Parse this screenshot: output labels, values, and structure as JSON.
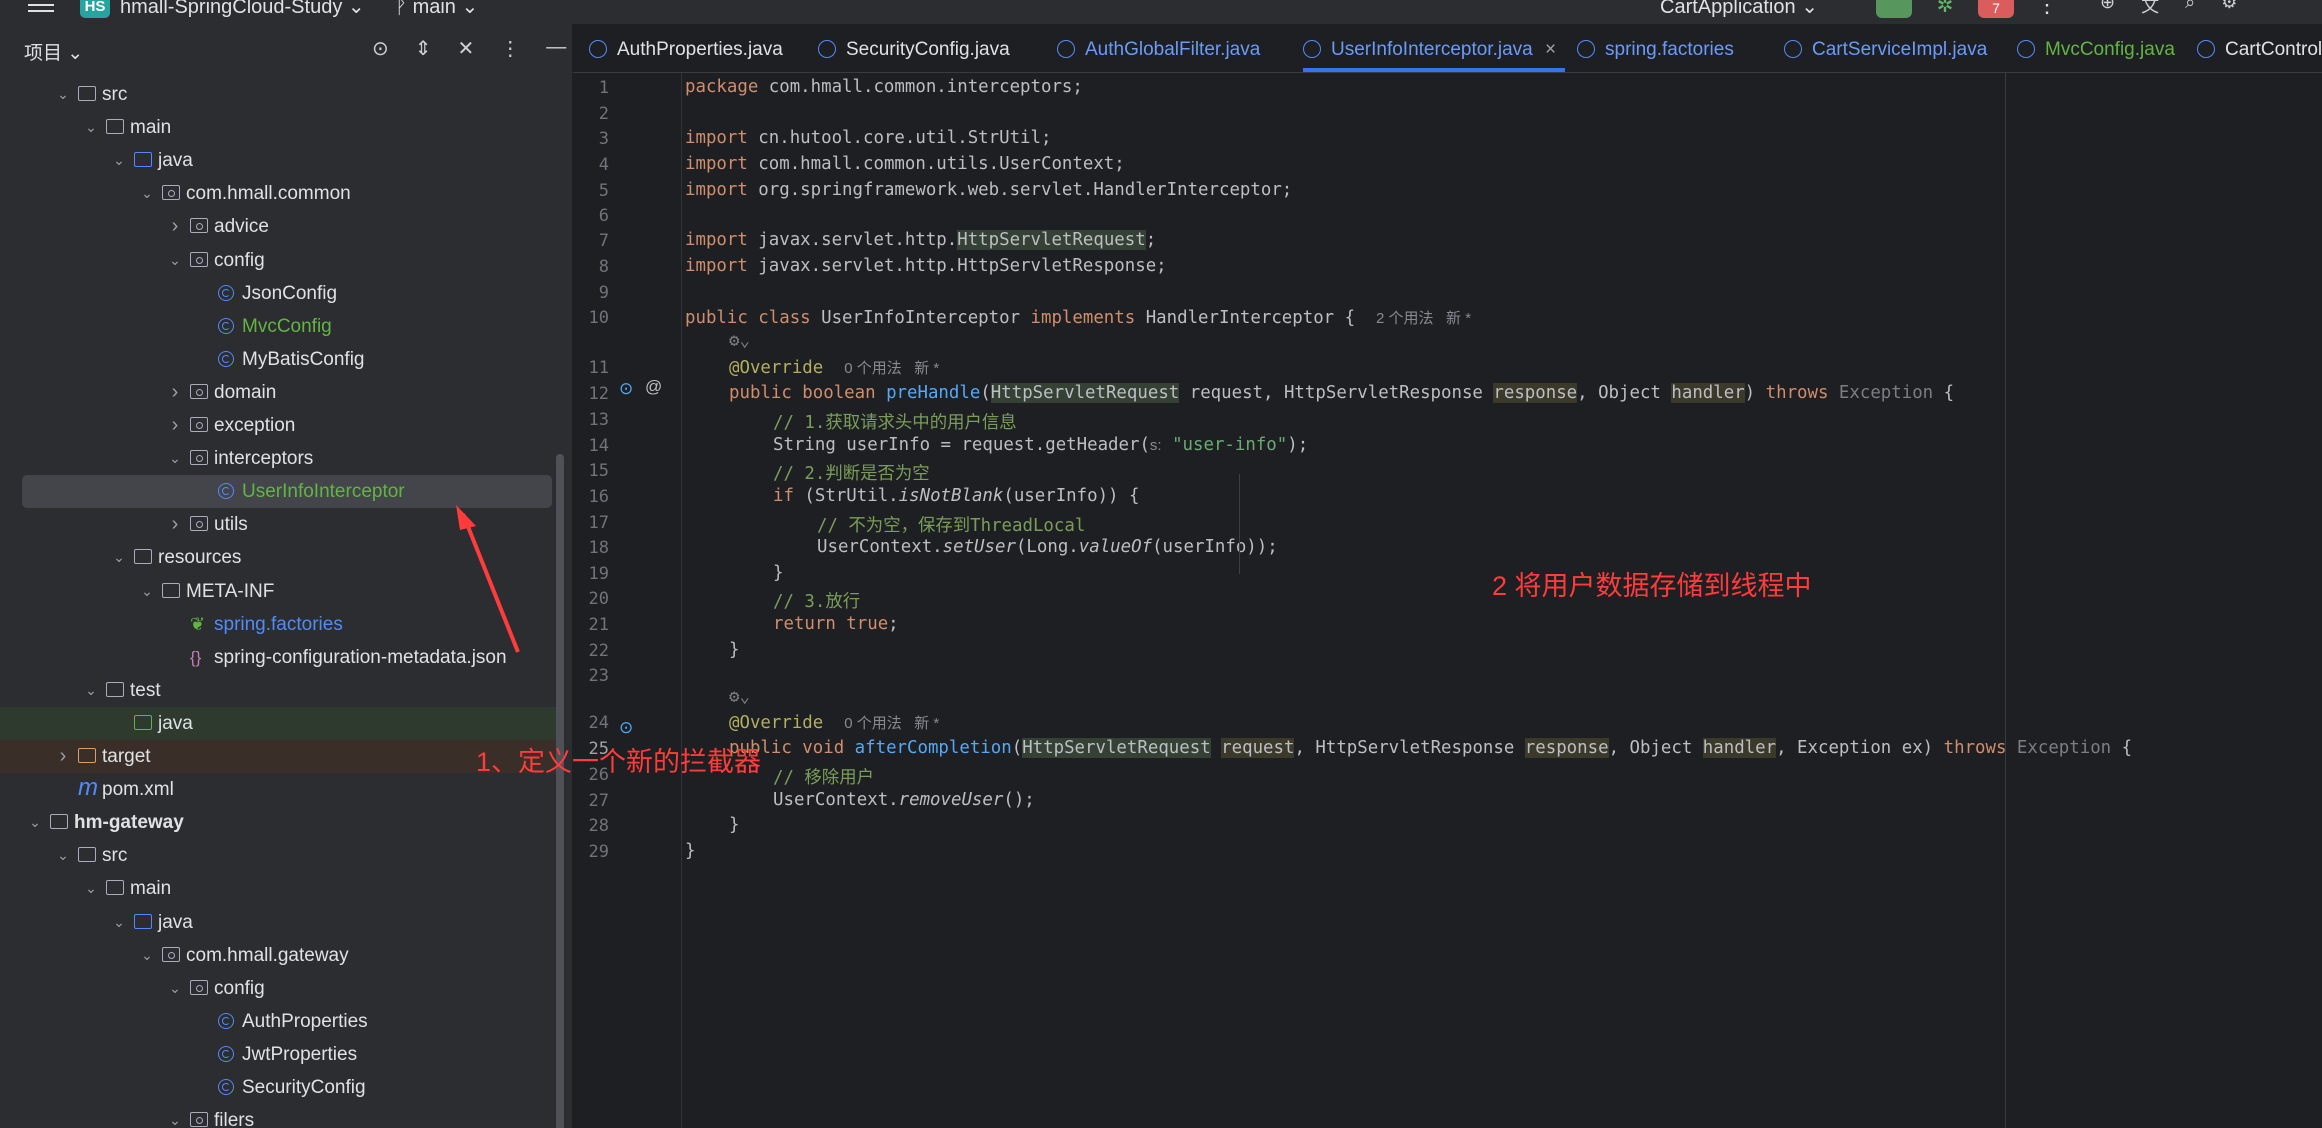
{
  "titlebar": {
    "project_badge": "HS",
    "project_name": "hmall-SpringCloud-Study",
    "branch": "main",
    "run_config": "CartApplication",
    "stop_badge": "7"
  },
  "project_panel": {
    "title": "项目",
    "items": [
      {
        "label": "src",
        "depth": 3,
        "arrow": "down",
        "icon": "folder"
      },
      {
        "label": "main",
        "depth": 4,
        "arrow": "down",
        "icon": "folder"
      },
      {
        "label": "java",
        "depth": 5,
        "arrow": "down",
        "icon": "folder-src"
      },
      {
        "label": "com.hmall.common",
        "depth": 6,
        "arrow": "down",
        "icon": "package"
      },
      {
        "label": "advice",
        "depth": 7,
        "arrow": "right",
        "icon": "package"
      },
      {
        "label": "config",
        "depth": 7,
        "arrow": "down",
        "icon": "package"
      },
      {
        "label": "JsonConfig",
        "depth": 8,
        "arrow": "",
        "icon": "class"
      },
      {
        "label": "MvcConfig",
        "depth": 8,
        "arrow": "",
        "icon": "class",
        "color": "#62b543"
      },
      {
        "label": "MyBatisConfig",
        "depth": 8,
        "arrow": "",
        "icon": "class"
      },
      {
        "label": "domain",
        "depth": 7,
        "arrow": "right",
        "icon": "package"
      },
      {
        "label": "exception",
        "depth": 7,
        "arrow": "right",
        "icon": "package"
      },
      {
        "label": "interceptors",
        "depth": 7,
        "arrow": "down",
        "icon": "package"
      },
      {
        "label": "UserInfoInterceptor",
        "depth": 8,
        "arrow": "",
        "icon": "class",
        "color": "#62b543",
        "selected": true
      },
      {
        "label": "utils",
        "depth": 7,
        "arrow": "right",
        "icon": "package"
      },
      {
        "label": "resources",
        "depth": 5,
        "arrow": "down",
        "icon": "folder"
      },
      {
        "label": "META-INF",
        "depth": 6,
        "arrow": "down",
        "icon": "folder"
      },
      {
        "label": "spring.factories",
        "depth": 7,
        "arrow": "",
        "icon": "factories",
        "color": "#548af7"
      },
      {
        "label": "spring-configuration-metadata.json",
        "depth": 7,
        "arrow": "",
        "icon": "json"
      },
      {
        "label": "test",
        "depth": 4,
        "arrow": "down",
        "icon": "folder"
      },
      {
        "label": "java",
        "depth": 5,
        "arrow": "",
        "icon": "folder-test",
        "bg": "green"
      },
      {
        "label": "target",
        "depth": 3,
        "arrow": "right",
        "icon": "folder-target",
        "bg": "orange"
      },
      {
        "label": "pom.xml",
        "depth": 3,
        "arrow": "",
        "icon": "maven"
      },
      {
        "label": "hm-gateway",
        "depth": 2,
        "arrow": "down",
        "icon": "module",
        "bold": true
      },
      {
        "label": "src",
        "depth": 3,
        "arrow": "down",
        "icon": "folder"
      },
      {
        "label": "main",
        "depth": 4,
        "arrow": "down",
        "icon": "folder"
      },
      {
        "label": "java",
        "depth": 5,
        "arrow": "down",
        "icon": "folder-src"
      },
      {
        "label": "com.hmall.gateway",
        "depth": 6,
        "arrow": "down",
        "icon": "package"
      },
      {
        "label": "config",
        "depth": 7,
        "arrow": "down",
        "icon": "package"
      },
      {
        "label": "AuthProperties",
        "depth": 8,
        "arrow": "",
        "icon": "class"
      },
      {
        "label": "JwtProperties",
        "depth": 8,
        "arrow": "",
        "icon": "class"
      },
      {
        "label": "SecurityConfig",
        "depth": 8,
        "arrow": "",
        "icon": "class"
      },
      {
        "label": "filers",
        "depth": 7,
        "arrow": "down",
        "icon": "package"
      }
    ]
  },
  "tabs": [
    {
      "label": "AuthProperties.java",
      "color": "#dfe1e5"
    },
    {
      "label": "SecurityConfig.java",
      "color": "#dfe1e5"
    },
    {
      "label": "AuthGlobalFilter.java",
      "color": "#6b9bf8"
    },
    {
      "label": "UserInfoInterceptor.java",
      "color": "#6b9bf8",
      "active": true
    },
    {
      "label": "spring.factories",
      "color": "#6b9bf8"
    },
    {
      "label": "CartServiceImpl.java",
      "color": "#6b9bf8"
    },
    {
      "label": "MvcConfig.java",
      "color": "#62b543"
    },
    {
      "label": "CartController",
      "color": "#dfe1e5"
    }
  ],
  "editor": {
    "line_numbers": [
      "1",
      "2",
      "3",
      "4",
      "5",
      "6",
      "7",
      "8",
      "9",
      "10",
      "11",
      "12",
      "13",
      "14",
      "15",
      "16",
      "17",
      "18",
      "19",
      "20",
      "21",
      "22",
      "23",
      "24",
      "25",
      "26",
      "27",
      "28",
      "29"
    ],
    "lines": {
      "l1_kw": "package",
      "l1_rest": " com.hmall.common.interceptors;",
      "import": "import",
      "l3": " cn.hutool.core.util.StrUtil;",
      "l4": " com.hmall.common.utils.UserContext;",
      "l5": " org.springframework.web.servlet.HandlerInterceptor;",
      "l7_a": " javax.servlet.http.",
      "l7_b": "HttpServletRequest",
      "l7_c": ";",
      "l8": " javax.servlet.http.HttpServletResponse;",
      "l10_kw1": "public class",
      "l10_a": " UserInfoInterceptor ",
      "l10_kw2": "implements",
      "l10_b": " HandlerInterceptor {",
      "l10_hint": "2 个用法   新 *",
      "override": "@Override",
      "usage_hint": "0 个用法   新 *",
      "l12_kw": "public boolean",
      "l12_fn": "preHandle",
      "l12_a": "(",
      "l12_type": "HttpServletRequest",
      "l12_b": " request, HttpServletResponse ",
      "l12_p1": "response",
      "l12_c": ", Object ",
      "l12_p2": "handler",
      "l12_d": ") ",
      "throws": "throws",
      "exception": " Exception",
      "l12_e": " {",
      "l13": "// 1.获取请求头中的用户信息",
      "l14_a": "String userInfo = request.getHeader(",
      "l14_hint": "s:",
      "l14_str": "\"user-info\"",
      "l14_b": ");",
      "l15": "// 2.判断是否为空",
      "l16_kw": "if",
      "l16_a": " (StrUtil.",
      "l16_it": "isNotBlank",
      "l16_b": "(userInfo)) {",
      "l17": "// 不为空，保存到ThreadLocal",
      "l18_a": "UserContext.",
      "l18_it1": "setUser",
      "l18_b": "(Long.",
      "l18_it2": "valueOf",
      "l18_c": "(userInfo));",
      "l19": "}",
      "l20": "// 3.放行",
      "l21_kw": "return true",
      "l21_b": ";",
      "l22": "}",
      "l25_kw": "public void",
      "l25_fn": "afterCompletion",
      "l25_a": "(",
      "l25_type": "HttpServletRequest",
      "l25_sp": " ",
      "l25_p0": "request",
      "l25_b": ", HttpServletResponse ",
      "l25_p1": "response",
      "l25_c": ", Object ",
      "l25_p2": "handler",
      "l25_d": ", Exception ex) ",
      "l26": "// 移除用户",
      "l27_a": "UserContext.",
      "l27_it": "removeUser",
      "l27_b": "();",
      "l28": "}",
      "l29": "}"
    }
  },
  "annotations": {
    "note1": "1、定义一个新的拦截器",
    "note2": "2 将用户数据存储到线程中"
  },
  "colors": {
    "accent": "#3574f0",
    "annotation_red": "#ff3b3b",
    "keyword": "#cf8e6d",
    "string": "#6aab73",
    "function": "#56a8f5"
  }
}
